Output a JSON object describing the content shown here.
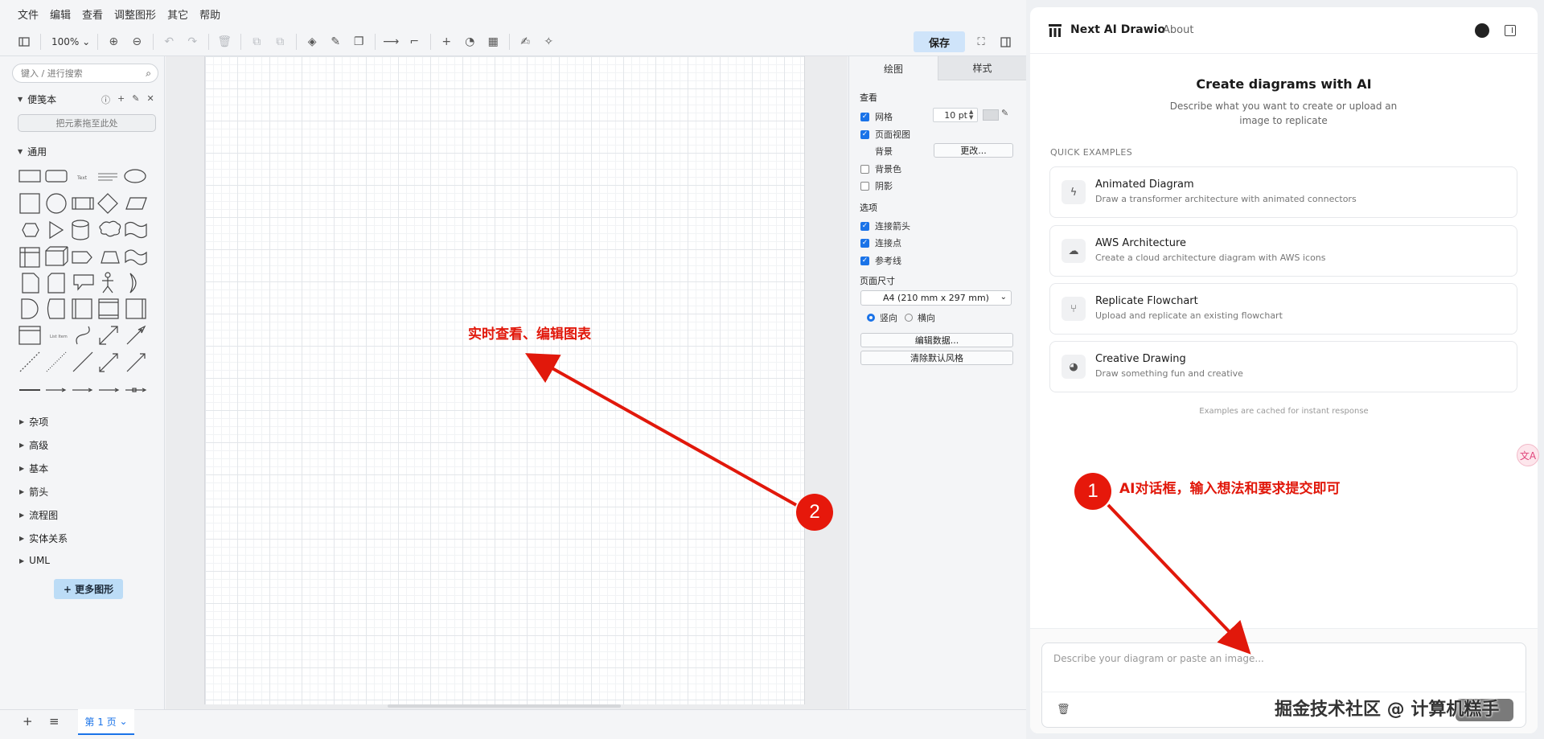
{
  "menu": [
    "文件",
    "编辑",
    "查看",
    "调整图形",
    "其它",
    "帮助"
  ],
  "toolbar": {
    "zoom": "100%",
    "save_label": "保存"
  },
  "shapes_panel": {
    "search_placeholder": "键入 / 进行搜索",
    "scratchpad_title": "便笺本",
    "drop_zone": "把元素拖至此处",
    "general_title": "通用",
    "libraries": [
      "杂项",
      "高级",
      "基本",
      "箭头",
      "流程图",
      "实体关系",
      "UML"
    ],
    "more_shapes": "+ 更多图形"
  },
  "format_panel": {
    "tab_diagram": "绘图",
    "tab_style": "样式",
    "view_title": "查看",
    "grid": "网格",
    "grid_size": "10 pt",
    "page_view": "页面视图",
    "background": "背景",
    "change_button": "更改...",
    "background_color": "背景色",
    "shadow": "阴影",
    "options_title": "选项",
    "connection_arrows": "连接箭头",
    "connection_points": "连接点",
    "guides": "参考线",
    "page_size_title": "页面尺寸",
    "page_size_value": "A4 (210 mm x 297 mm)",
    "portrait": "竖向",
    "landscape": "横向",
    "edit_data": "编辑数据...",
    "clear_style": "清除默认风格"
  },
  "bottom": {
    "page_tab": "第 1 页"
  },
  "ai_panel": {
    "brand": "Next AI Drawio",
    "about": "About",
    "title": "Create diagrams with AI",
    "subtitle": "Describe what you want to create or upload an image to replicate",
    "quick_examples_label": "QUICK EXAMPLES",
    "examples": [
      {
        "title": "Animated Diagram",
        "desc": "Draw a transformer architecture with animated connectors",
        "icon": "lightning-icon"
      },
      {
        "title": "AWS Architecture",
        "desc": "Create a cloud architecture diagram with AWS icons",
        "icon": "cloud-icon"
      },
      {
        "title": "Replicate Flowchart",
        "desc": "Upload and replicate an existing flowchart",
        "icon": "git-branch-icon"
      },
      {
        "title": "Creative Drawing",
        "desc": "Draw something fun and creative",
        "icon": "palette-icon"
      }
    ],
    "cached_note": "Examples are cached for instant response",
    "input_placeholder": "Describe your diagram or paste an image..."
  },
  "annotations": {
    "badge_1": "1",
    "text_1": "AI对话框，输入想法和要求提交即可",
    "badge_2": "2",
    "text_2": "实时查看、编辑图表"
  },
  "watermark": "掘金技术社区 @ 计算机糕手",
  "colors": {
    "accent": "#1a73e8",
    "annotation_red": "#e1180b",
    "save_bg": "#cfe4fa"
  }
}
